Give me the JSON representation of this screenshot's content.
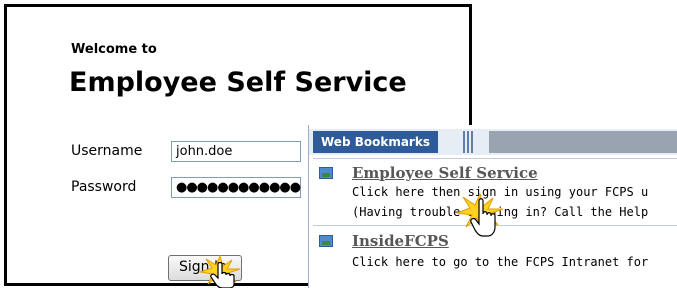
{
  "login": {
    "welcome": "Welcome to",
    "title": "Employee Self Service",
    "username_label": "Username",
    "username_value": "john.doe",
    "password_label": "Password",
    "password_value": "●●●●●●●●●●●●",
    "signin_label": "Sign In"
  },
  "bookmarks": {
    "header": "Web Bookmarks",
    "items": [
      {
        "title": "Employee Self Service",
        "line1": "Click here then sign in using your FCPS u",
        "line2": "(Having trouble signing in? Call the Help"
      },
      {
        "title": "InsideFCPS",
        "line1": "Click here to go to the FCPS Intranet for"
      }
    ]
  },
  "colors": {
    "tab": "#2e5c9a",
    "link": "#575757",
    "burst": "#ffd21f"
  },
  "icons": [
    "bookmark-icon",
    "hand-cursor-icon",
    "click-burst-icon"
  ]
}
